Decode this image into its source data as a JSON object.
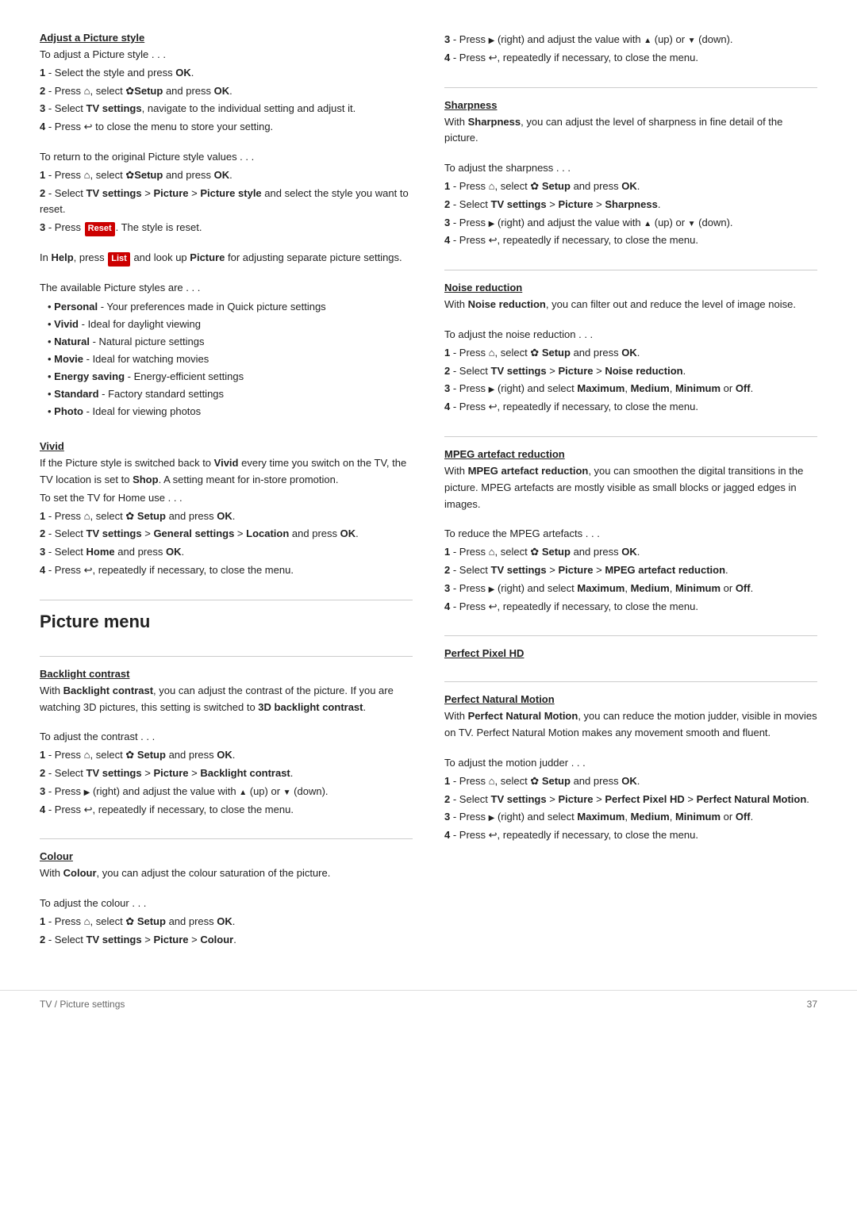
{
  "page": {
    "footer_left": "TV / Picture settings",
    "footer_right": "37"
  },
  "left_col": {
    "section_adjust_style": {
      "title": "Adjust a Picture style",
      "intro": "To adjust a Picture style . . .",
      "steps": [
        "1 - Select the style and press OK.",
        "2 - Press [home], select [setup] Setup and press OK.",
        "3 - Select TV settings, navigate to the individual setting and adjust it.",
        "4 - Press [back] to close the menu to store your setting."
      ],
      "return_intro": "To return to the original Picture style values . . .",
      "return_steps": [
        "1 - Press [home], select [setup] Setup and press OK.",
        "2 - Select TV settings > Picture > Picture style and select the style you want to reset.",
        "3 - Press [red]Reset[/red]. The style is reset."
      ],
      "help_note": "In Help, press [red]List[/red] and look up Picture for adjusting separate picture settings.",
      "available_title": "The available Picture styles are . . .",
      "bullets": [
        "Personal - Your preferences made in Quick picture settings",
        "Vivid - Ideal for daylight viewing",
        "Natural - Natural picture settings",
        "Movie - Ideal for watching movies",
        "Energy saving - Energy-efficient settings",
        "Standard - Factory standard settings",
        "Photo - Ideal for viewing photos"
      ]
    },
    "section_vivid": {
      "title": "Vivid",
      "body": "If the Picture style is switched back to Vivid every time you switch on the TV, the TV location is set to Shop. A setting meant for in-store promotion.",
      "set_home_intro": "To set the TV for Home use . . .",
      "steps": [
        "1 - Press [home], select [setup] Setup and press OK.",
        "2 - Select TV settings > General settings > Location and press OK.",
        "3 - Select Home and press OK.",
        "4 - Press [back], repeatedly if necessary, to close the menu."
      ]
    },
    "divider1": true,
    "section_picture_menu": {
      "title": "Picture menu"
    },
    "section_backlight": {
      "title": "Backlight contrast",
      "body": "With Backlight contrast, you can adjust the contrast of the picture. If you are watching 3D pictures, this setting is switched to 3D backlight contrast.",
      "intro": "To adjust the contrast . . .",
      "steps": [
        "1 - Press [home], select [setup] Setup and press OK.",
        "2 - Select TV settings > Picture > Backlight contrast.",
        "3 - Press [right] (right) and adjust the value with [up] (up) or [down] (down).",
        "4 - Press [back], repeatedly if necessary, to close the menu."
      ]
    },
    "divider2": true,
    "section_colour": {
      "title": "Colour",
      "body": "With Colour, you can adjust the colour saturation of the picture.",
      "intro": "To adjust the colour . . .",
      "steps": [
        "1 - Press [home], select [setup] Setup and press OK.",
        "2 - Select TV settings > Picture > Colour."
      ]
    }
  },
  "right_col": {
    "colour_cont_steps": [
      "3 - Press [right] (right) and adjust the value with [up] (up) or [down] (down).",
      "4 - Press [back], repeatedly if necessary, to close the menu."
    ],
    "divider1": true,
    "section_sharpness": {
      "title": "Sharpness",
      "body": "With Sharpness, you can adjust the level of sharpness in fine detail of the picture.",
      "intro": "To adjust the sharpness . . .",
      "steps": [
        "1 - Press [home], select [setup] Setup and press OK.",
        "2 - Select TV settings > Picture > Sharpness.",
        "3 - Press [right] (right) and adjust the value with [up] (up) or [down] (down).",
        "4 - Press [back], repeatedly if necessary, to close the menu."
      ]
    },
    "divider2": true,
    "section_noise": {
      "title": "Noise reduction",
      "body": "With Noise reduction, you can filter out and reduce the level of image noise.",
      "intro": "To adjust the noise reduction . . .",
      "steps": [
        "1 - Press [home], select [setup] Setup and press OK.",
        "2 - Select TV settings > Picture > Noise reduction.",
        "3 - Press [right] (right) and select Maximum, Medium, Minimum or Off.",
        "4 - Press [back], repeatedly if necessary, to close the menu."
      ]
    },
    "divider3": true,
    "section_mpeg": {
      "title": "MPEG artefact reduction",
      "body": "With MPEG artefact reduction, you can smoothen the digital transitions in the picture. MPEG artefacts are mostly visible as small blocks or jagged edges in images.",
      "intro": "To reduce the MPEG artefacts . . .",
      "steps": [
        "1 - Press [home], select [setup] Setup and press OK.",
        "2 - Select TV settings > Picture > MPEG artefact reduction.",
        "3 - Press [right] (right) and select Maximum, Medium, Minimum or Off.",
        "4 - Press [back], repeatedly if necessary, to close the menu."
      ]
    },
    "divider4": true,
    "section_ppHD": {
      "title": "Perfect Pixel HD"
    },
    "divider5": true,
    "section_pnm": {
      "title": "Perfect Natural Motion",
      "body": "With Perfect Natural Motion, you can reduce the motion judder, visible in movies on TV. Perfect Natural Motion makes any movement smooth and fluent.",
      "intro": "To adjust the motion judder . . .",
      "steps": [
        "1 - Press [home], select [setup] Setup and press OK.",
        "2 - Select TV settings > Picture > Perfect Pixel HD > Perfect Natural Motion.",
        "3 - Press [right] (right) and select Maximum, Medium, Minimum or Off.",
        "4 - Press [back], repeatedly if necessary, to close the menu."
      ]
    }
  }
}
